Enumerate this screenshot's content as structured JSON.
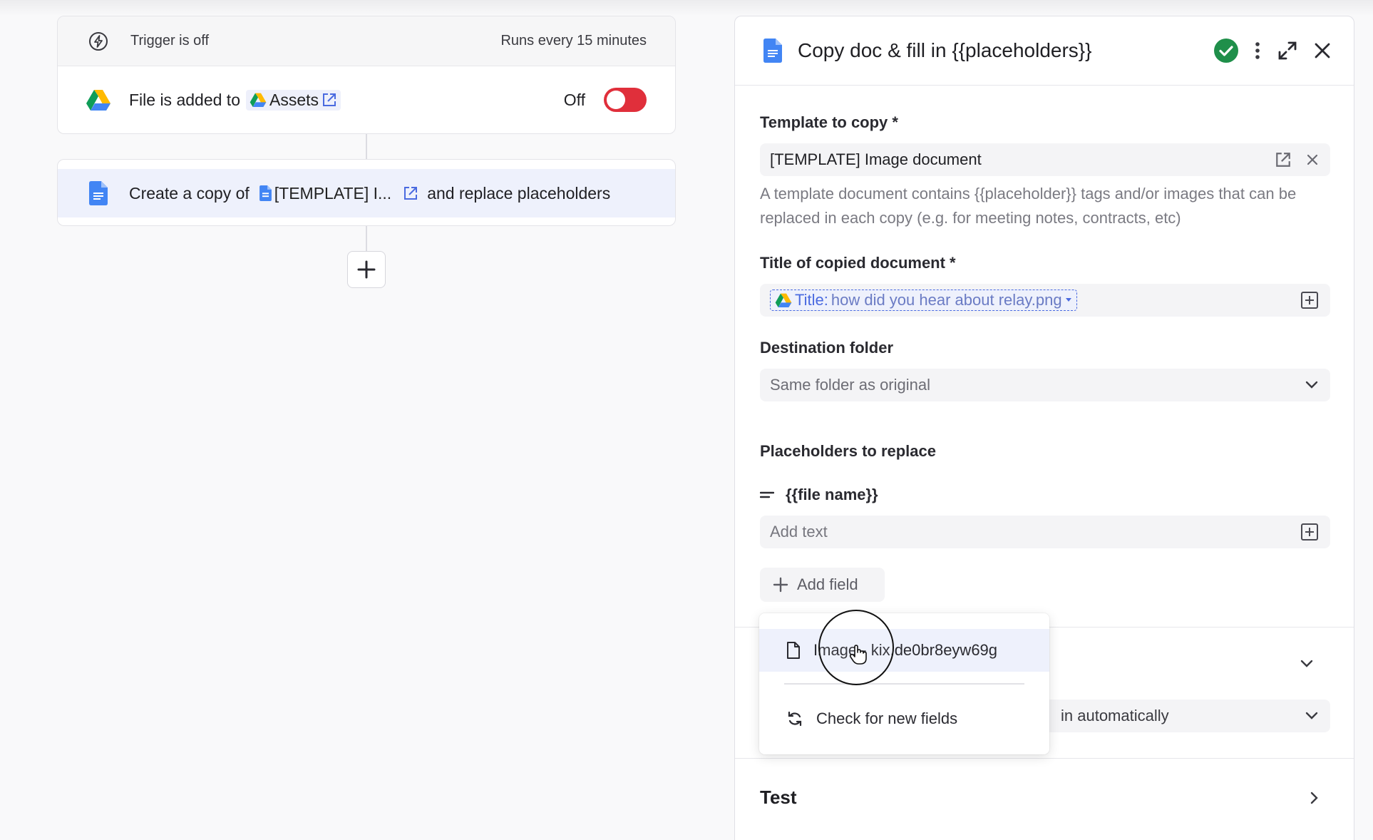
{
  "workflow": {
    "trigger": {
      "status": "Trigger is off",
      "schedule": "Runs every 15 minutes",
      "event_prefix": "File is added to",
      "folder_name": "Assets",
      "toggle_label": "Off",
      "toggle_on": false
    },
    "action": {
      "prefix": "Create a copy of",
      "doc_name": "[TEMPLATE] I...",
      "suffix": "and replace placeholders"
    }
  },
  "panel": {
    "title": "Copy doc & fill in {{placeholders}}",
    "template_label": "Template to copy *",
    "template_value": "[TEMPLATE] Image document",
    "template_help": "A template document contains {{placeholder}} tags and/or images that can be replaced in each copy (e.g. for meeting notes, contracts, etc)",
    "title_label": "Title of copied document *",
    "title_var_key": "Title:",
    "title_var_value": "how did you hear about relay.png",
    "dest_label": "Destination folder",
    "dest_value": "Same folder as original",
    "placeholders_label": "Placeholders to replace",
    "placeholder_name": "{{file name}}",
    "placeholder_input": "Add text",
    "add_field_label": "Add field",
    "hidden_select_text": "in automatically",
    "test_label": "Test"
  },
  "dropdown": {
    "items": [
      {
        "label": "Image - kix.de0br8eyw69g",
        "icon": "file-icon"
      },
      {
        "label": "Check for new fields",
        "icon": "refresh-icon"
      }
    ]
  },
  "colors": {
    "accent_blue": "#4a6ae0",
    "toggle_red": "#e02f3b",
    "success_green": "#1f8f4a"
  }
}
